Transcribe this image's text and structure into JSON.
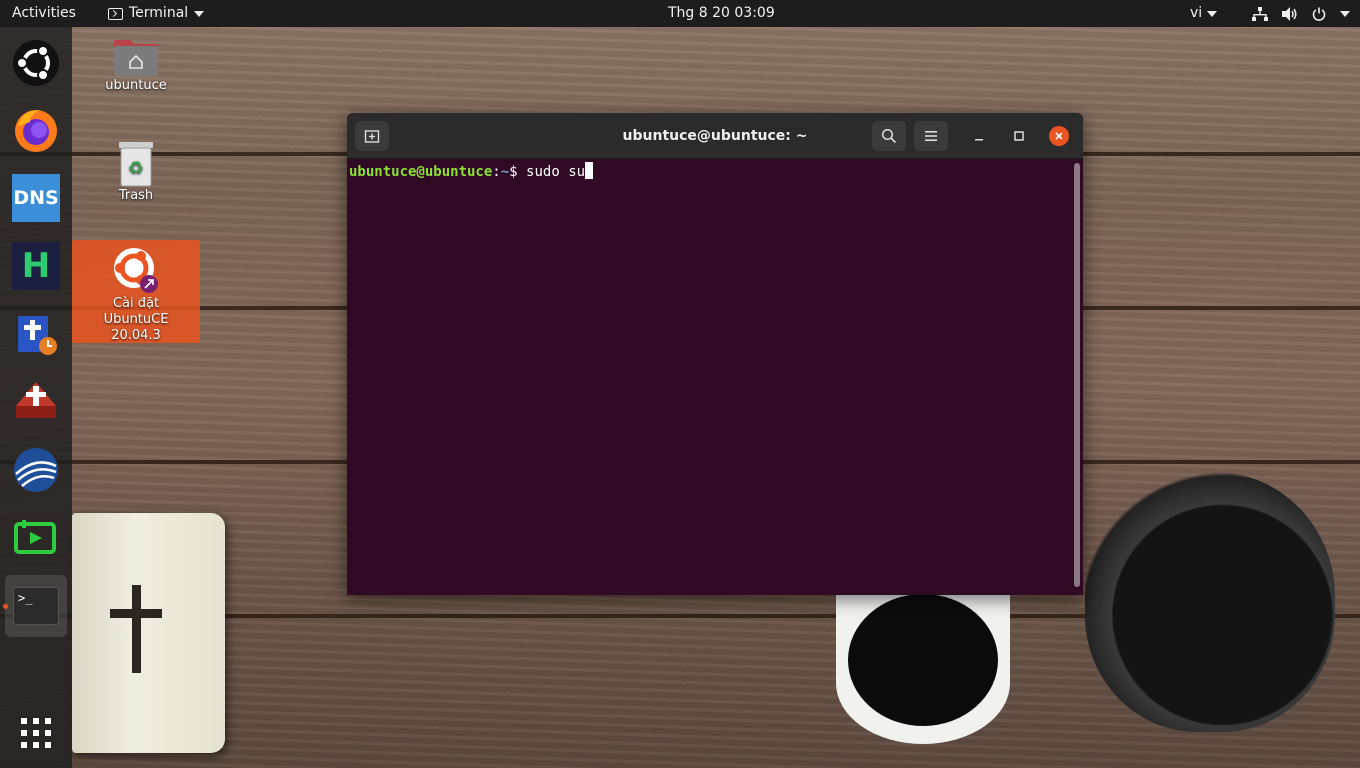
{
  "topbar": {
    "activities": "Activities",
    "app_name": "Terminal",
    "clock": "Thg 8 20  03:09",
    "input_source": "vi"
  },
  "desktop": {
    "icons": [
      {
        "label": "ubuntuce",
        "icon": "home-folder-icon"
      },
      {
        "label": "Trash",
        "icon": "trash-icon"
      },
      {
        "label": "Cài đặt UbuntuCE 20.04.3",
        "icon": "ubuntu-installer-icon"
      }
    ]
  },
  "dock": {
    "items": [
      {
        "name": "ubuntu-logo",
        "icon": "ubuntu-logo-icon"
      },
      {
        "name": "firefox",
        "icon": "firefox-icon"
      },
      {
        "name": "dns",
        "icon": "dns-icon",
        "text": "DNS"
      },
      {
        "name": "h-app",
        "icon": "h-app-icon",
        "text": "H"
      },
      {
        "name": "bible-app",
        "icon": "bible-app-icon"
      },
      {
        "name": "church-app",
        "icon": "church-app-icon"
      },
      {
        "name": "sphere-app",
        "icon": "sphere-app-icon"
      },
      {
        "name": "screen-share",
        "icon": "screen-share-icon"
      },
      {
        "name": "terminal",
        "icon": "terminal-icon",
        "text": ">_"
      },
      {
        "name": "show-applications",
        "icon": "grid-icon"
      }
    ]
  },
  "terminal": {
    "title": "ubuntuce@ubuntuce: ~",
    "prompt_user": "ubuntuce@ubuntuce",
    "prompt_sep": ":",
    "prompt_path": "~",
    "prompt_symbol": "$",
    "command": "sudo su"
  },
  "colors": {
    "terminal_bg": "#300a24",
    "prompt_user": "#8ae234",
    "prompt_path": "#729fcf",
    "accent": "#e95420"
  }
}
